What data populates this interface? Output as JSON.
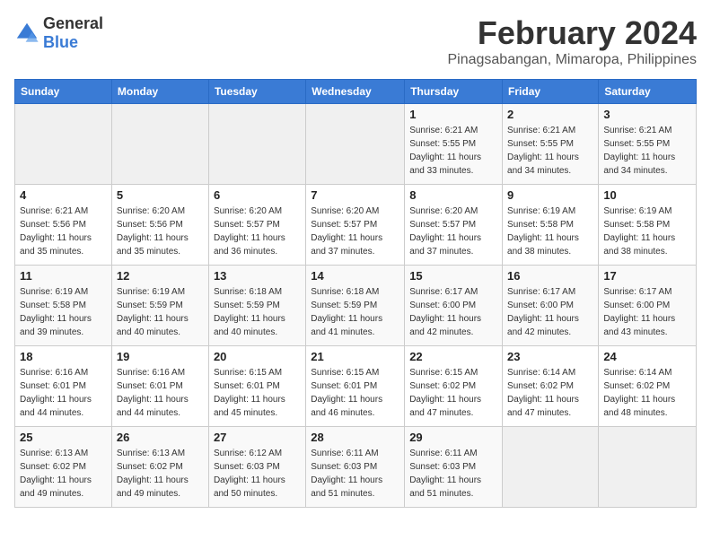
{
  "header": {
    "logo_general": "General",
    "logo_blue": "Blue",
    "main_title": "February 2024",
    "subtitle": "Pinagsabangan, Mimaropa, Philippines"
  },
  "calendar": {
    "columns": [
      "Sunday",
      "Monday",
      "Tuesday",
      "Wednesday",
      "Thursday",
      "Friday",
      "Saturday"
    ],
    "weeks": [
      [
        {
          "day": "",
          "info": ""
        },
        {
          "day": "",
          "info": ""
        },
        {
          "day": "",
          "info": ""
        },
        {
          "day": "",
          "info": ""
        },
        {
          "day": "1",
          "info": "Sunrise: 6:21 AM\nSunset: 5:55 PM\nDaylight: 11 hours\nand 33 minutes."
        },
        {
          "day": "2",
          "info": "Sunrise: 6:21 AM\nSunset: 5:55 PM\nDaylight: 11 hours\nand 34 minutes."
        },
        {
          "day": "3",
          "info": "Sunrise: 6:21 AM\nSunset: 5:55 PM\nDaylight: 11 hours\nand 34 minutes."
        }
      ],
      [
        {
          "day": "4",
          "info": "Sunrise: 6:21 AM\nSunset: 5:56 PM\nDaylight: 11 hours\nand 35 minutes."
        },
        {
          "day": "5",
          "info": "Sunrise: 6:20 AM\nSunset: 5:56 PM\nDaylight: 11 hours\nand 35 minutes."
        },
        {
          "day": "6",
          "info": "Sunrise: 6:20 AM\nSunset: 5:57 PM\nDaylight: 11 hours\nand 36 minutes."
        },
        {
          "day": "7",
          "info": "Sunrise: 6:20 AM\nSunset: 5:57 PM\nDaylight: 11 hours\nand 37 minutes."
        },
        {
          "day": "8",
          "info": "Sunrise: 6:20 AM\nSunset: 5:57 PM\nDaylight: 11 hours\nand 37 minutes."
        },
        {
          "day": "9",
          "info": "Sunrise: 6:19 AM\nSunset: 5:58 PM\nDaylight: 11 hours\nand 38 minutes."
        },
        {
          "day": "10",
          "info": "Sunrise: 6:19 AM\nSunset: 5:58 PM\nDaylight: 11 hours\nand 38 minutes."
        }
      ],
      [
        {
          "day": "11",
          "info": "Sunrise: 6:19 AM\nSunset: 5:58 PM\nDaylight: 11 hours\nand 39 minutes."
        },
        {
          "day": "12",
          "info": "Sunrise: 6:19 AM\nSunset: 5:59 PM\nDaylight: 11 hours\nand 40 minutes."
        },
        {
          "day": "13",
          "info": "Sunrise: 6:18 AM\nSunset: 5:59 PM\nDaylight: 11 hours\nand 40 minutes."
        },
        {
          "day": "14",
          "info": "Sunrise: 6:18 AM\nSunset: 5:59 PM\nDaylight: 11 hours\nand 41 minutes."
        },
        {
          "day": "15",
          "info": "Sunrise: 6:17 AM\nSunset: 6:00 PM\nDaylight: 11 hours\nand 42 minutes."
        },
        {
          "day": "16",
          "info": "Sunrise: 6:17 AM\nSunset: 6:00 PM\nDaylight: 11 hours\nand 42 minutes."
        },
        {
          "day": "17",
          "info": "Sunrise: 6:17 AM\nSunset: 6:00 PM\nDaylight: 11 hours\nand 43 minutes."
        }
      ],
      [
        {
          "day": "18",
          "info": "Sunrise: 6:16 AM\nSunset: 6:01 PM\nDaylight: 11 hours\nand 44 minutes."
        },
        {
          "day": "19",
          "info": "Sunrise: 6:16 AM\nSunset: 6:01 PM\nDaylight: 11 hours\nand 44 minutes."
        },
        {
          "day": "20",
          "info": "Sunrise: 6:15 AM\nSunset: 6:01 PM\nDaylight: 11 hours\nand 45 minutes."
        },
        {
          "day": "21",
          "info": "Sunrise: 6:15 AM\nSunset: 6:01 PM\nDaylight: 11 hours\nand 46 minutes."
        },
        {
          "day": "22",
          "info": "Sunrise: 6:15 AM\nSunset: 6:02 PM\nDaylight: 11 hours\nand 47 minutes."
        },
        {
          "day": "23",
          "info": "Sunrise: 6:14 AM\nSunset: 6:02 PM\nDaylight: 11 hours\nand 47 minutes."
        },
        {
          "day": "24",
          "info": "Sunrise: 6:14 AM\nSunset: 6:02 PM\nDaylight: 11 hours\nand 48 minutes."
        }
      ],
      [
        {
          "day": "25",
          "info": "Sunrise: 6:13 AM\nSunset: 6:02 PM\nDaylight: 11 hours\nand 49 minutes."
        },
        {
          "day": "26",
          "info": "Sunrise: 6:13 AM\nSunset: 6:02 PM\nDaylight: 11 hours\nand 49 minutes."
        },
        {
          "day": "27",
          "info": "Sunrise: 6:12 AM\nSunset: 6:03 PM\nDaylight: 11 hours\nand 50 minutes."
        },
        {
          "day": "28",
          "info": "Sunrise: 6:11 AM\nSunset: 6:03 PM\nDaylight: 11 hours\nand 51 minutes."
        },
        {
          "day": "29",
          "info": "Sunrise: 6:11 AM\nSunset: 6:03 PM\nDaylight: 11 hours\nand 51 minutes."
        },
        {
          "day": "",
          "info": ""
        },
        {
          "day": "",
          "info": ""
        }
      ]
    ]
  }
}
